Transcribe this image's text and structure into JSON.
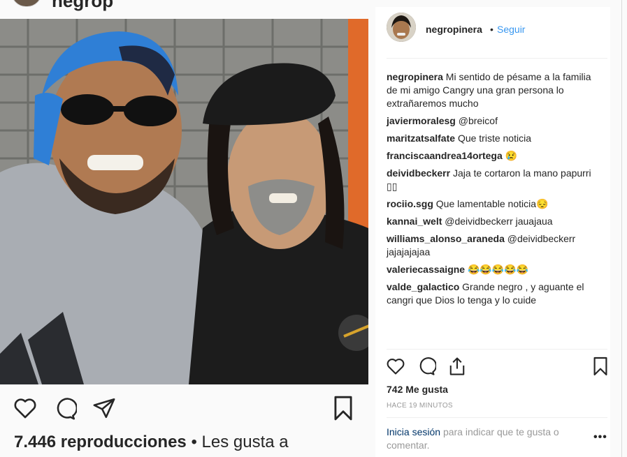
{
  "header": {
    "username_cropped": "negrop"
  },
  "post": {
    "username": "negropinera",
    "follow_label": "Seguir",
    "dot": "•",
    "caption": "Mi sentido de pésame a la familia de mi amigo Cangry una gran persona lo extrañaremos mucho",
    "comments": [
      {
        "user": "javiermoralesg",
        "text": "@breicof"
      },
      {
        "user": "maritzatsalfate",
        "text": "Que triste noticia"
      },
      {
        "user": "franciscaandrea14ortega",
        "text": "😢"
      },
      {
        "user": "deividbeckerr",
        "text": "Jaja te cortaron la mano papurri ▯▯"
      },
      {
        "user": "rociio.sgg",
        "text": "Que lamentable noticia😔"
      },
      {
        "user": "kannai_welt",
        "text": "@deividbeckerr jauajaua"
      },
      {
        "user": "williams_alonso_araneda",
        "text": "@deividbeckerr jajajajajaa"
      },
      {
        "user": "valeriecassaigne",
        "text": "😂😂😂😂😂"
      },
      {
        "user": "valde_galactico",
        "text": "Grande negro , y aguante el cangri que Dios lo tenga y lo cuide"
      }
    ],
    "likes": "742 Me gusta",
    "time": "HACE 19 MINUTOS",
    "login_link": "Inicia sesión",
    "login_rest": "para indicar que te gusta o comentar.",
    "more": "•••"
  },
  "left": {
    "views_count": "7.446 reproducciones",
    "views_rest": " • Les gusta a"
  },
  "icons": {
    "like": "heart-icon",
    "comment": "comment-icon",
    "share": "share-icon",
    "save": "bookmark-icon"
  }
}
